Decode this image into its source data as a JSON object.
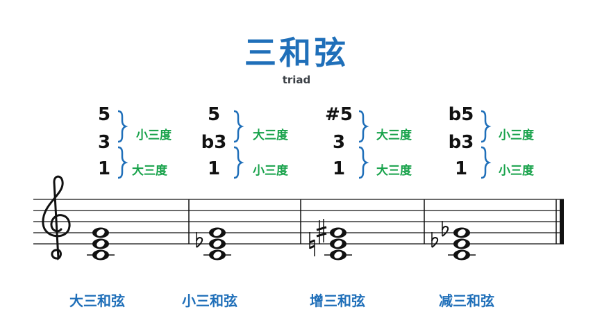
{
  "title": "三和弦",
  "subtitle": "triad",
  "colors": {
    "accent": "#1f6fb9",
    "interval": "#17a24a",
    "bracket": "#1f6fb9",
    "ink": "#111111"
  },
  "chords": [
    {
      "name": "大三和弦",
      "degrees": [
        "5",
        "3",
        "1"
      ],
      "intervals": [
        "小三度",
        "大三度"
      ],
      "accidentals": []
    },
    {
      "name": "小三和弦",
      "degrees": [
        "5",
        "b3",
        "1"
      ],
      "intervals": [
        "大三度",
        "小三度"
      ],
      "accidentals": [
        "flat"
      ]
    },
    {
      "name": "增三和弦",
      "degrees": [
        "#5",
        "3",
        "1"
      ],
      "intervals": [
        "大三度",
        "大三度"
      ],
      "accidentals": [
        "natural",
        "sharp"
      ]
    },
    {
      "name": "减三和弦",
      "degrees": [
        "b5",
        "b3",
        "1"
      ],
      "intervals": [
        "小三度",
        "小三度"
      ],
      "accidentals": [
        "flat",
        "flat"
      ]
    }
  ]
}
